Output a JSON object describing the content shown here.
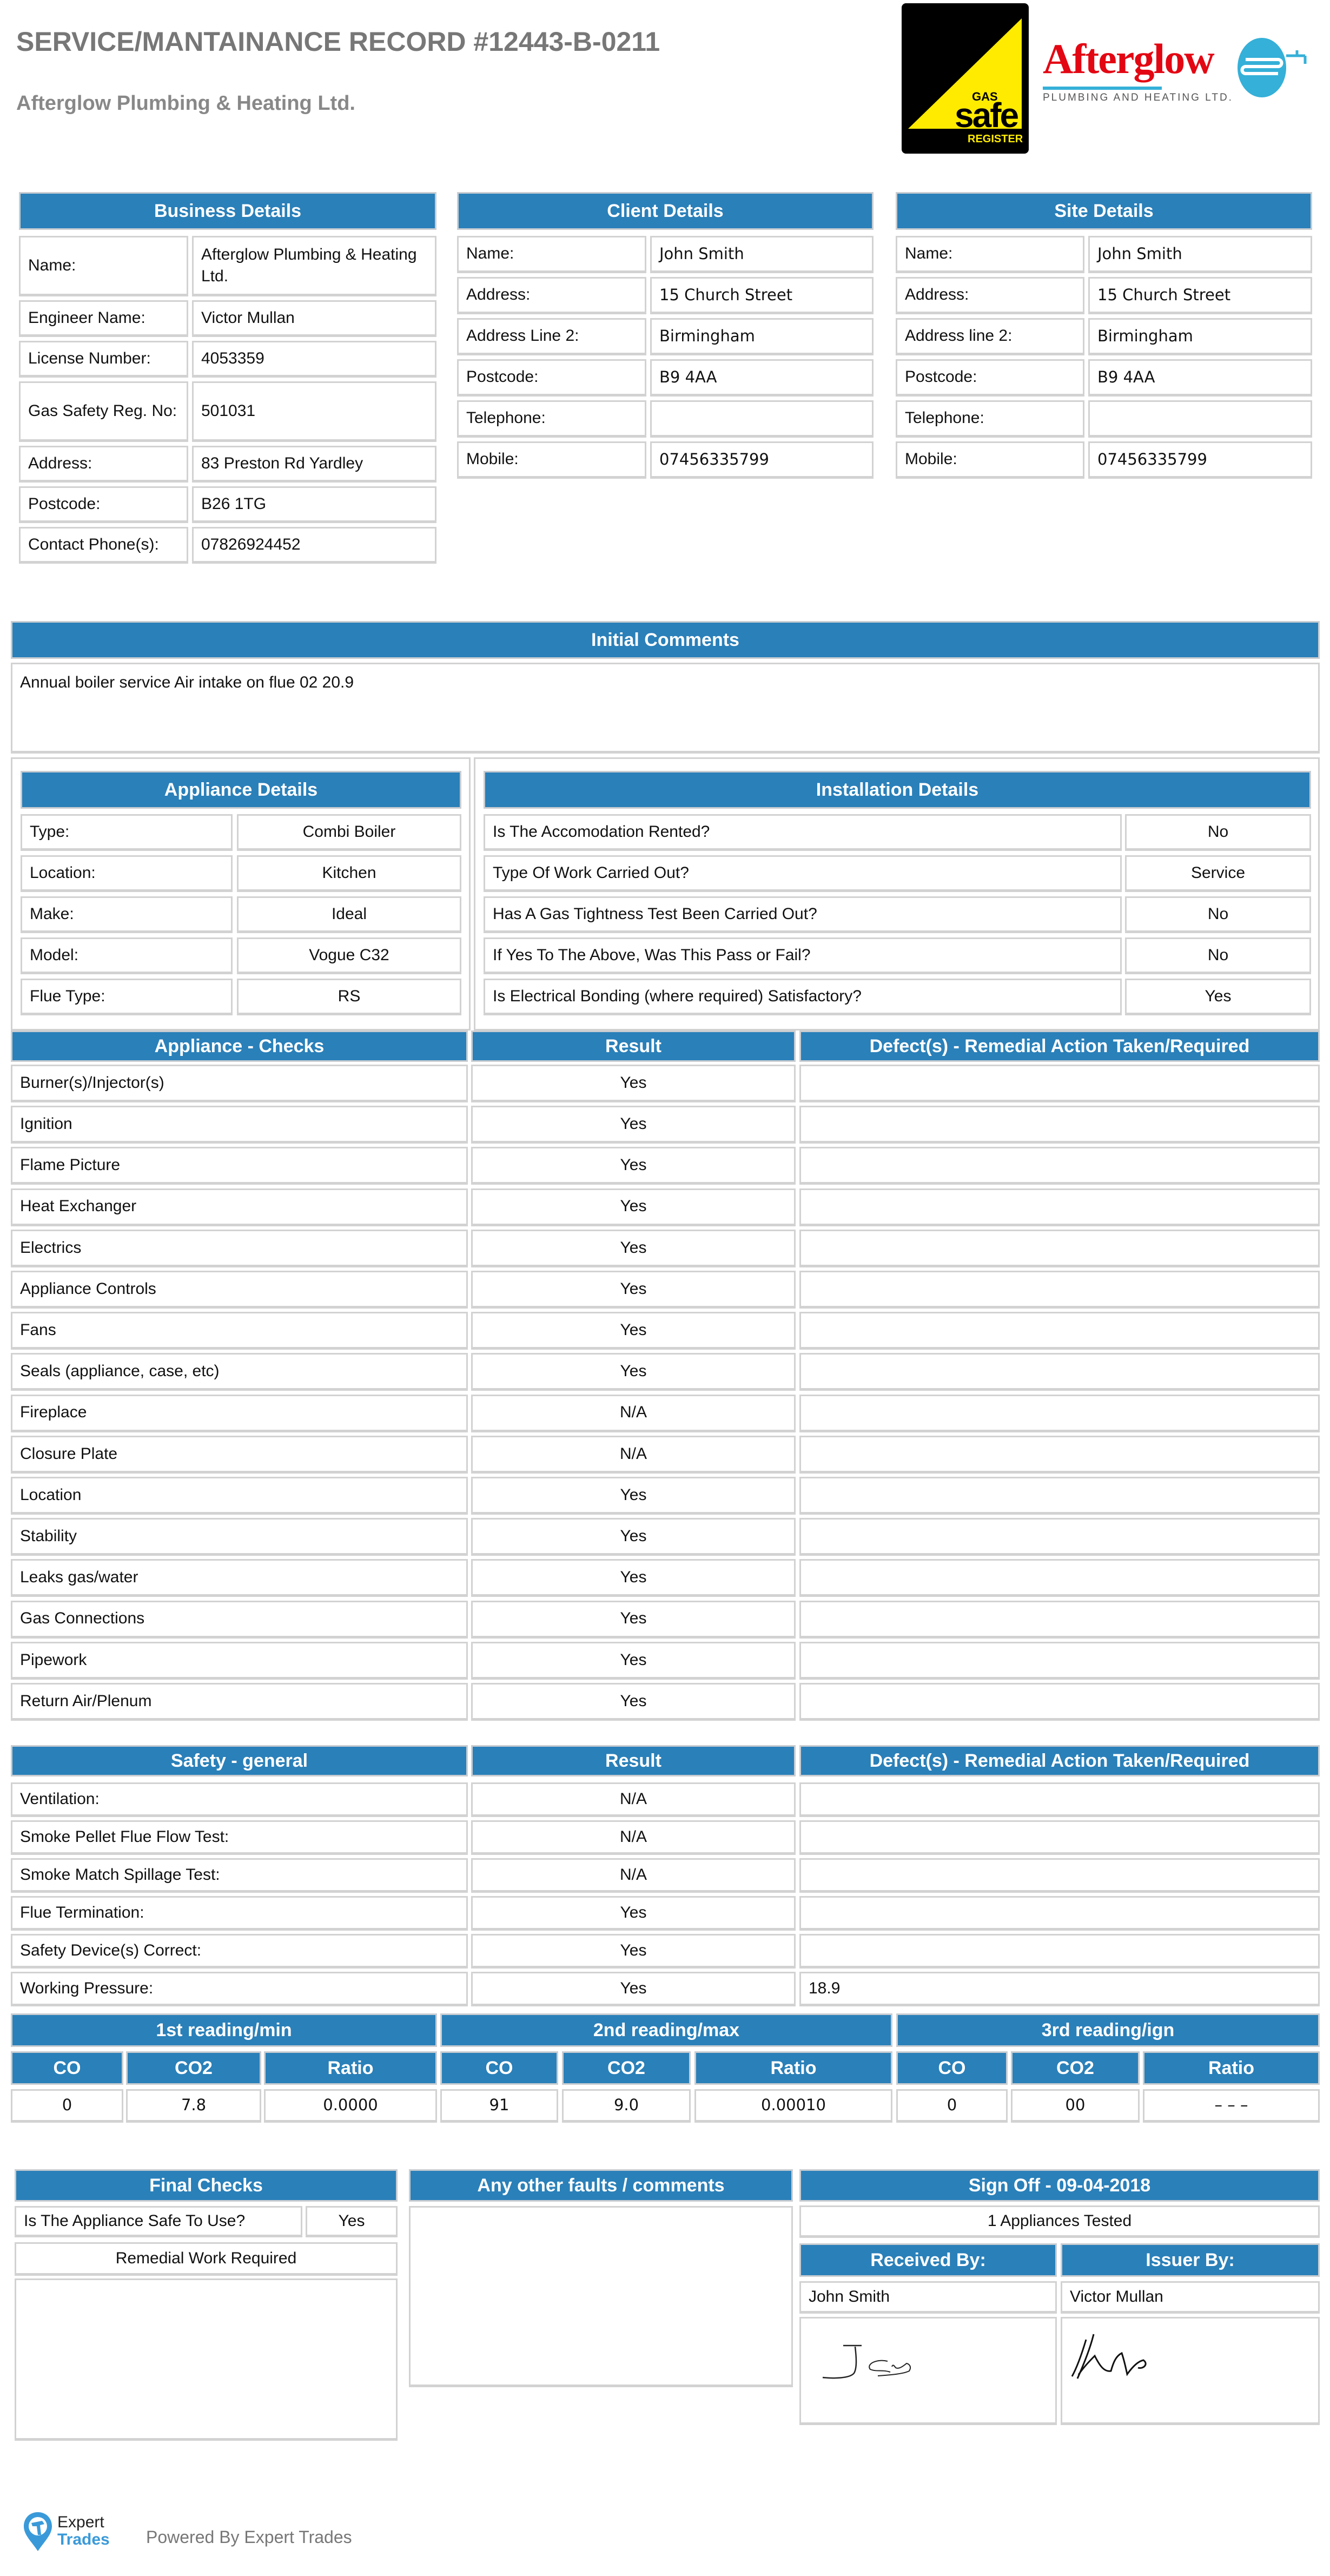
{
  "header": {
    "title": "SERVICE/MANTAINANCE RECORD #12443-B-0211",
    "company": "Afterglow Plumbing & Heating Ltd.",
    "gas_safe_logo": {
      "top": "GAS",
      "main": "safe",
      "bottom": "REGISTER",
      "colors": {
        "bg": "#000000",
        "triangle": "#ffeb00"
      }
    },
    "brand_logo": {
      "name": "Afterglow",
      "tagline": "PLUMBING AND HEATING LTD.",
      "colors": {
        "name": "#e30613",
        "accent": "#35b0d8",
        "tagline": "#555555"
      }
    }
  },
  "colors": {
    "header_blue": "#2a80b9",
    "border": "#d2d2d2"
  },
  "business": {
    "title": "Business Details",
    "rows": [
      {
        "label": "Name:",
        "value": "Afterglow Plumbing & Heating Ltd."
      },
      {
        "label": "Engineer Name:",
        "value": "Victor Mullan"
      },
      {
        "label": "License Number:",
        "value": "4053359"
      },
      {
        "label": "Gas Safety Reg. No:",
        "value": "501031"
      },
      {
        "label": "Address:",
        "value": "83 Preston Rd Yardley"
      },
      {
        "label": "Postcode:",
        "value": "B26 1TG"
      },
      {
        "label": "Contact Phone(s):",
        "value": "07826924452"
      }
    ]
  },
  "client": {
    "title": "Client Details",
    "rows": [
      {
        "label": "Name:",
        "value": "John Smith"
      },
      {
        "label": "Address:",
        "value": "15 Church Street"
      },
      {
        "label": "Address Line 2:",
        "value": "Birmingham"
      },
      {
        "label": "Postcode:",
        "value": "B9 4AA"
      },
      {
        "label": "Telephone:",
        "value": ""
      },
      {
        "label": "Mobile:",
        "value": "07456335799"
      }
    ]
  },
  "site": {
    "title": "Site Details",
    "rows": [
      {
        "label": "Name:",
        "value": "John Smith"
      },
      {
        "label": "Address:",
        "value": "15 Church Street"
      },
      {
        "label": "Address line 2:",
        "value": "Birmingham"
      },
      {
        "label": "Postcode:",
        "value": "B9 4AA"
      },
      {
        "label": "Telephone:",
        "value": ""
      },
      {
        "label": "Mobile:",
        "value": "07456335799"
      }
    ]
  },
  "initial_comments": {
    "title": "Initial Comments",
    "text": "Annual boiler service Air intake on flue 02 20.9"
  },
  "appliance": {
    "title": "Appliance Details",
    "rows": [
      {
        "label": "Type:",
        "value": "Combi Boiler"
      },
      {
        "label": "Location:",
        "value": "Kitchen"
      },
      {
        "label": "Make:",
        "value": "Ideal"
      },
      {
        "label": "Model:",
        "value": "Vogue C32"
      },
      {
        "label": "Flue Type:",
        "value": "RS"
      }
    ]
  },
  "installation": {
    "title": "Installation Details",
    "rows": [
      {
        "label": "Is The Accomodation Rented?",
        "value": "No"
      },
      {
        "label": "Type Of Work Carried Out?",
        "value": "Service"
      },
      {
        "label": "Has A Gas Tightness Test Been Carried Out?",
        "value": "No"
      },
      {
        "label": "If Yes To The Above, Was This Pass or Fail?",
        "value": "No"
      },
      {
        "label": "Is Electrical Bonding (where required) Satisfactory?",
        "value": "Yes"
      }
    ]
  },
  "checks": {
    "headers": [
      "Appliance - Checks",
      "Result",
      "Defect(s) - Remedial Action Taken/Required"
    ],
    "rows": [
      {
        "label": "Burner(s)/Injector(s)",
        "result": "Yes",
        "defect": ""
      },
      {
        "label": "Ignition",
        "result": "Yes",
        "defect": ""
      },
      {
        "label": "Flame Picture",
        "result": "Yes",
        "defect": ""
      },
      {
        "label": "Heat Exchanger",
        "result": "Yes",
        "defect": ""
      },
      {
        "label": "Electrics",
        "result": "Yes",
        "defect": ""
      },
      {
        "label": "Appliance Controls",
        "result": "Yes",
        "defect": ""
      },
      {
        "label": "Fans",
        "result": "Yes",
        "defect": ""
      },
      {
        "label": "Seals (appliance, case, etc)",
        "result": "Yes",
        "defect": ""
      },
      {
        "label": "Fireplace",
        "result": "N/A",
        "defect": ""
      },
      {
        "label": "Closure Plate",
        "result": "N/A",
        "defect": ""
      },
      {
        "label": "Location",
        "result": "Yes",
        "defect": ""
      },
      {
        "label": "Stability",
        "result": "Yes",
        "defect": ""
      },
      {
        "label": "Leaks gas/water",
        "result": "Yes",
        "defect": ""
      },
      {
        "label": "Gas Connections",
        "result": "Yes",
        "defect": ""
      },
      {
        "label": "Pipework",
        "result": "Yes",
        "defect": ""
      },
      {
        "label": "Return Air/Plenum",
        "result": "Yes",
        "defect": ""
      }
    ]
  },
  "safety": {
    "headers": [
      "Safety - general",
      "Result",
      "Defect(s) - Remedial Action Taken/Required"
    ],
    "rows": [
      {
        "label": "Ventilation:",
        "result": "N/A",
        "defect": ""
      },
      {
        "label": "Smoke Pellet Flue Flow Test:",
        "result": "N/A",
        "defect": ""
      },
      {
        "label": "Smoke Match Spillage Test:",
        "result": "N/A",
        "defect": ""
      },
      {
        "label": "Flue Termination:",
        "result": "Yes",
        "defect": ""
      },
      {
        "label": "Safety Device(s) Correct:",
        "result": "Yes",
        "defect": ""
      },
      {
        "label": "Working Pressure:",
        "result": "Yes",
        "defect": "18.9"
      }
    ]
  },
  "readings": [
    {
      "title": "1st reading/min",
      "cols": [
        "CO",
        "CO2",
        "Ratio"
      ],
      "values": [
        "0",
        "7.8",
        "0.0000"
      ]
    },
    {
      "title": "2nd reading/max",
      "cols": [
        "CO",
        "CO2",
        "Ratio"
      ],
      "values": [
        "91",
        "9.0",
        "0.00010"
      ]
    },
    {
      "title": "3rd reading/ign",
      "cols": [
        "CO",
        "CO2",
        "Ratio"
      ],
      "values": [
        "0",
        "00",
        "– – –"
      ]
    }
  ],
  "final_checks": {
    "title": "Final Checks",
    "safe_label": "Is The Appliance Safe To Use?",
    "safe_value": "Yes",
    "remedial_label": "Remedial Work Required",
    "remedial_text": ""
  },
  "other_faults": {
    "title": "Any other faults / comments",
    "text": ""
  },
  "sign_off": {
    "title": "Sign Off - 09-04-2018",
    "appliances_tested": "1 Appliances Tested",
    "received_by_label": "Received By:",
    "issuer_by_label": "Issuer By:",
    "received_by_name": "John Smith",
    "issuer_by_name": "Victor Mullan"
  },
  "footer": {
    "logo_top": "Expert",
    "logo_bottom": "Trades",
    "powered_by": "Powered By Expert Trades"
  }
}
